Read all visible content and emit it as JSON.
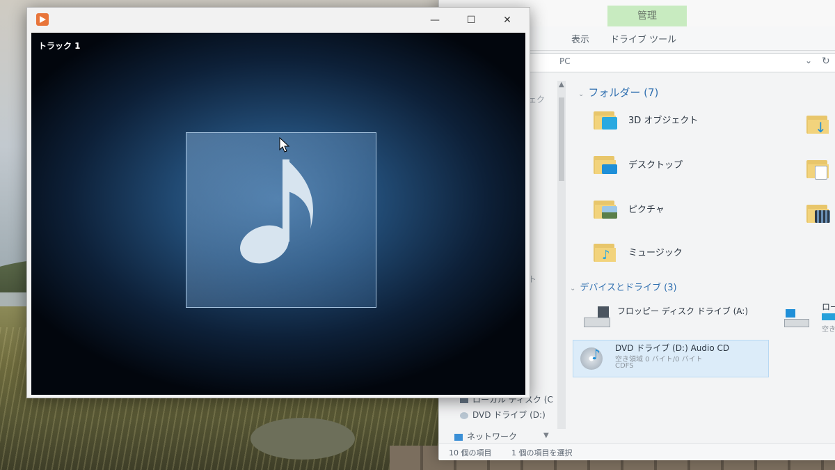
{
  "player": {
    "window_controls": {
      "minimize": "—",
      "maximize": "☐",
      "close": "✕"
    },
    "now_playing": "トラック 1",
    "album_art_icon": "music-note-icon"
  },
  "explorer": {
    "context_tab": "管理",
    "ribbon_tabs": [
      "表示",
      "ドライブ ツール"
    ],
    "address_path": "PC",
    "nav_fragments": [
      "ェク",
      "ト"
    ],
    "nav_items": {
      "local_disk": "ローカル ディスク (C",
      "dvd_drive": "DVD ドライブ (D:)",
      "network": "ネットワーク"
    },
    "folders_group": "フォルダー (7)",
    "folders": [
      "3D オブジェクト",
      "デスクトップ",
      "ピクチャ",
      "ミュージック"
    ],
    "devices_group": "デバイスとドライブ (3)",
    "devices": {
      "floppy": "フロッピー ディスク ドライブ (A:)",
      "local_disk_partial": "ロー",
      "local_disk_sub_partial": "空き",
      "dvd_name": "DVD ドライブ (D:) Audio CD",
      "dvd_space": "空き領域 0 バイト/0 バイト",
      "dvd_fs": "CDFS"
    },
    "status": {
      "item_count": "10 個の項目",
      "selected": "1 個の項目を選択"
    }
  }
}
